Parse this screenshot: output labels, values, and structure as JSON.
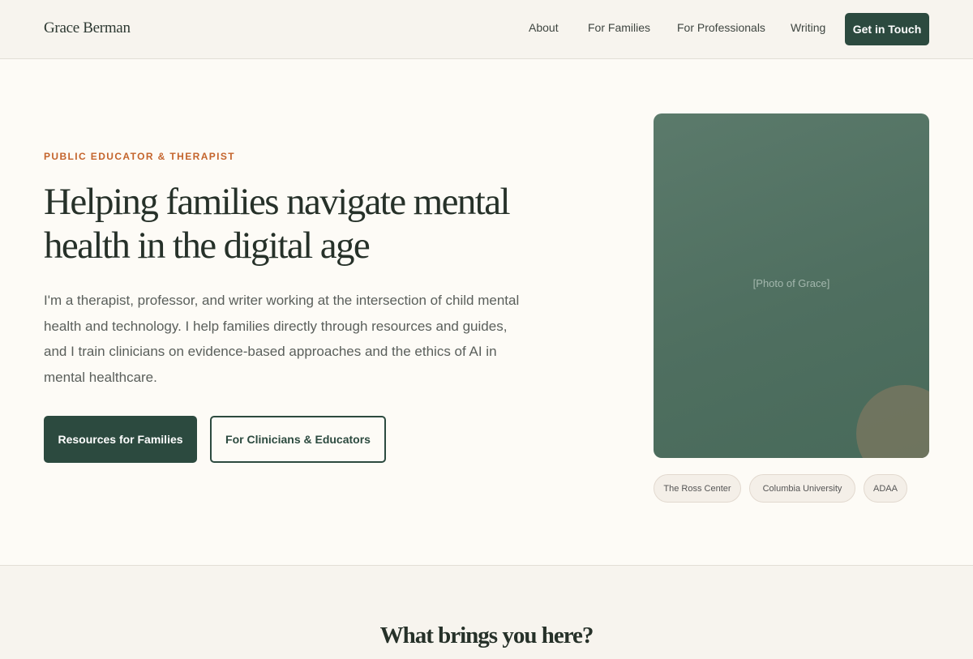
{
  "header": {
    "logo": "Grace Berman",
    "nav": {
      "about": "About",
      "families": "For Families",
      "professionals": "For Professionals",
      "writing": "Writing"
    },
    "cta": "Get in Touch"
  },
  "hero": {
    "eyebrow": "PUBLIC EDUCATOR & THERAPIST",
    "headline": "Helping families navigate mental health in the digital age",
    "intro": "I'm a therapist, professor, and writer working at the intersection of child mental health and technology. I help families directly through resources and guides, and I train clinicians on evidence-based approaches and the ethics of AI in mental healthcare.",
    "primary_button": "Resources for Families",
    "secondary_button": "For Clinicians & Educators",
    "photo_label": "[Photo of Grace]",
    "affiliations": [
      "The Ross Center",
      "Columbia University",
      "ADAA"
    ]
  },
  "section2": {
    "title": "What brings you here?"
  },
  "colors": {
    "accent_green": "#2c4a3f",
    "eyebrow_orange": "#c4642c",
    "photo_green": "#557465",
    "background": "#fdfbf6"
  }
}
